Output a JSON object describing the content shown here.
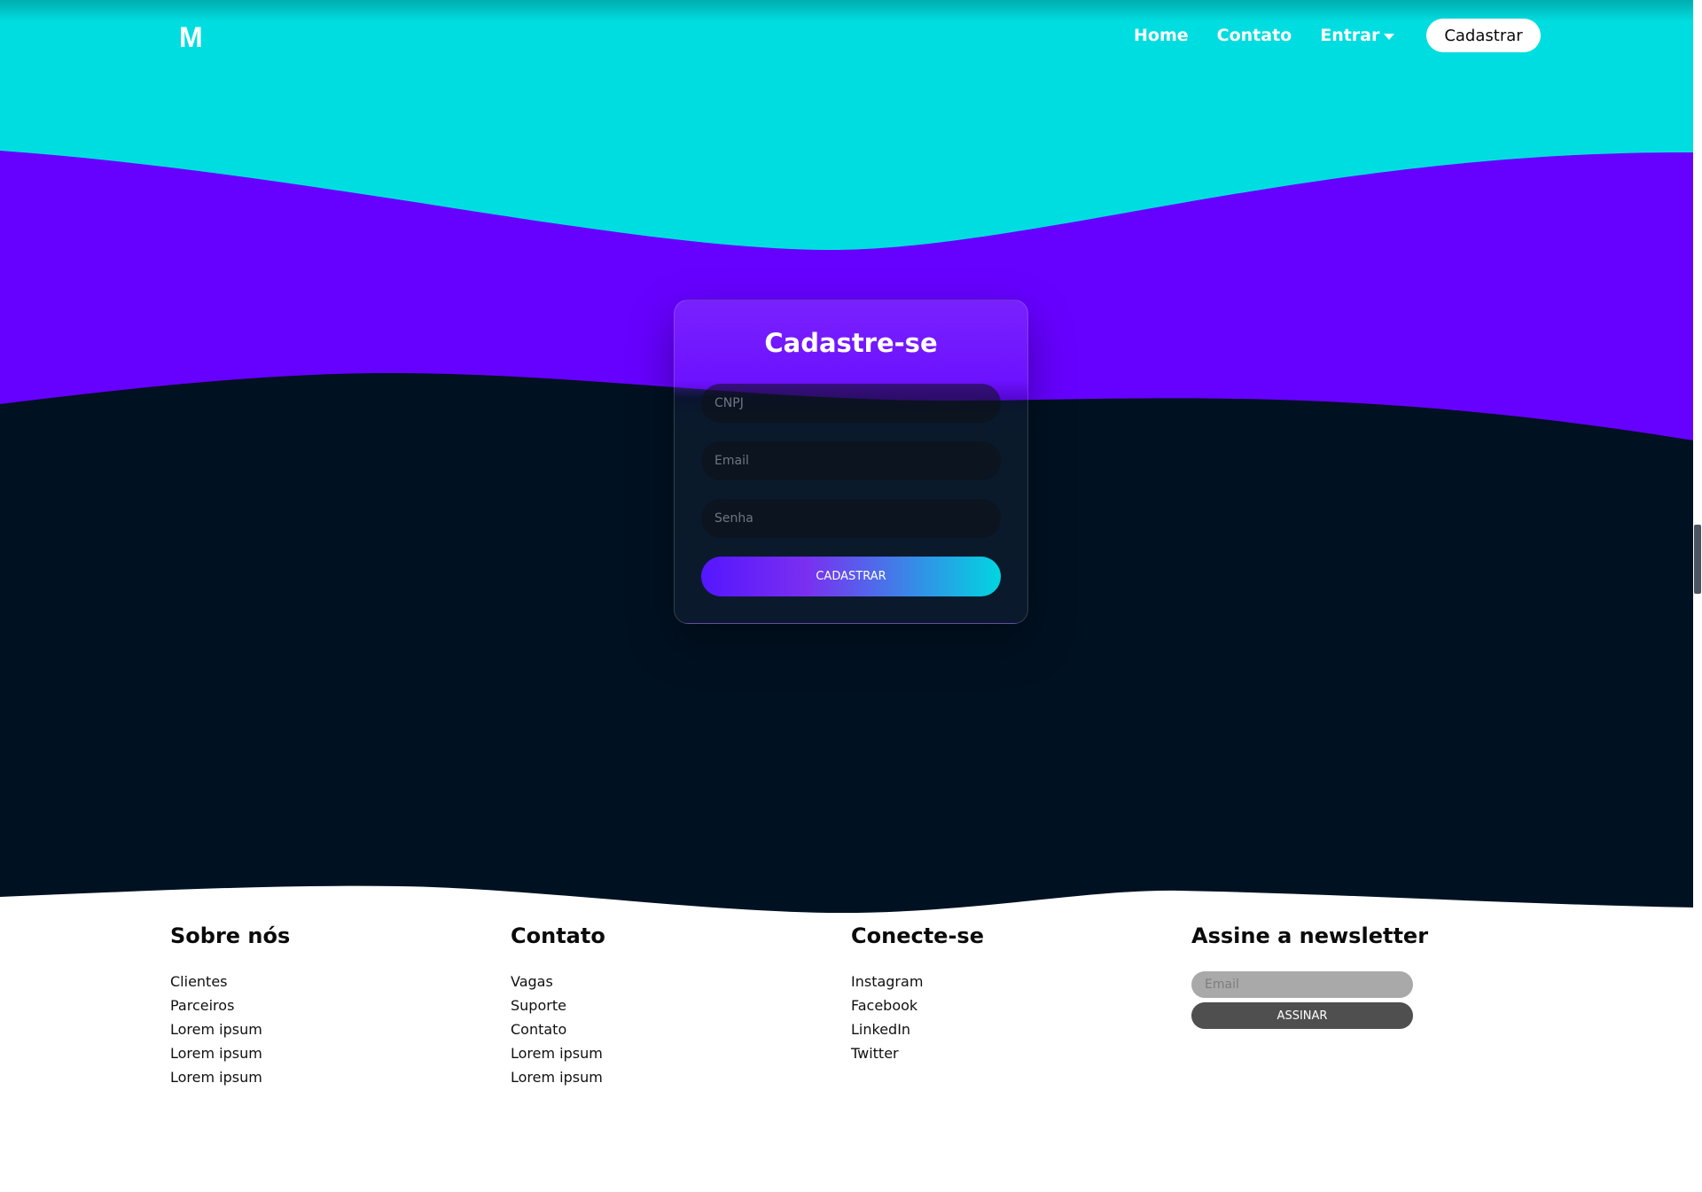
{
  "colors": {
    "header_cyan": "#00dde0",
    "wave_purple": "#6600ff",
    "dark_navy": "#001122",
    "footer_white": "#ffffff",
    "button_gradient_start": "#5416ff",
    "button_gradient_end": "#00d6e0"
  },
  "navbar": {
    "logo_text": "M",
    "links": [
      {
        "label": "Home"
      },
      {
        "label": "Contato"
      },
      {
        "label": "Entrar",
        "icon": "caret-down-icon"
      }
    ],
    "cta_label": "Cadastrar"
  },
  "register_form": {
    "title": "Cadastre-se",
    "fields": [
      {
        "placeholder": "CNPJ",
        "value": ""
      },
      {
        "placeholder": "Email",
        "value": ""
      },
      {
        "placeholder": "Senha",
        "value": ""
      }
    ],
    "submit_label": "CADASTRAR"
  },
  "footer": {
    "columns": [
      {
        "heading": "Sobre nós",
        "items": [
          "Clientes",
          "Parceiros",
          "Lorem ipsum",
          "Lorem ipsum",
          "Lorem ipsum"
        ]
      },
      {
        "heading": "Contato",
        "items": [
          "Vagas",
          "Suporte",
          "Contato",
          "Lorem ipsum",
          "Lorem ipsum"
        ]
      },
      {
        "heading": "Conecte-se",
        "items": [
          "Instagram",
          "Facebook",
          "LinkedIn",
          "Twitter"
        ]
      }
    ],
    "newsletter": {
      "heading": "Assine a newsletter",
      "placeholder": "Email",
      "value": "",
      "button_label": "ASSINAR"
    }
  }
}
